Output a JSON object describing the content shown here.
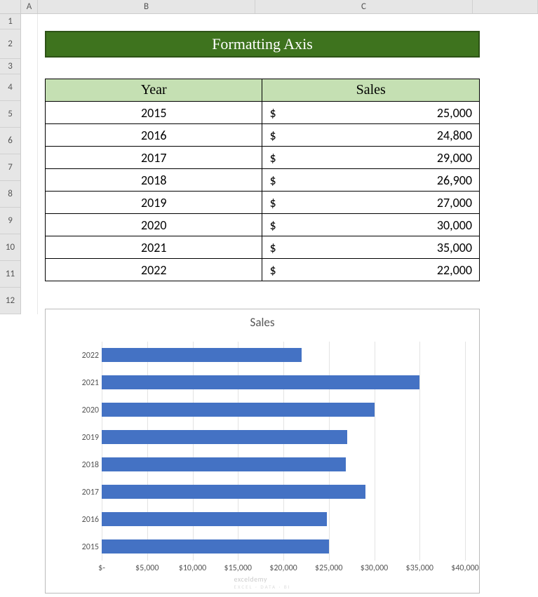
{
  "columns": [
    "A",
    "B",
    "C"
  ],
  "rows": [
    "1",
    "2",
    "3",
    "4",
    "5",
    "6",
    "7",
    "8",
    "9",
    "10",
    "11",
    "12"
  ],
  "banner": {
    "title": "Formatting Axis"
  },
  "table": {
    "headers": {
      "year": "Year",
      "sales": "Sales"
    },
    "currency": "$",
    "rows": [
      {
        "year": "2015",
        "sales": "25,000"
      },
      {
        "year": "2016",
        "sales": "24,800"
      },
      {
        "year": "2017",
        "sales": "29,000"
      },
      {
        "year": "2018",
        "sales": "26,900"
      },
      {
        "year": "2019",
        "sales": "27,000"
      },
      {
        "year": "2020",
        "sales": "30,000"
      },
      {
        "year": "2021",
        "sales": "35,000"
      },
      {
        "year": "2022",
        "sales": "22,000"
      }
    ]
  },
  "chart_data": {
    "type": "bar",
    "title": "Sales",
    "orientation": "horizontal",
    "categories": [
      "2022",
      "2021",
      "2020",
      "2019",
      "2018",
      "2017",
      "2016",
      "2015"
    ],
    "values": [
      22000,
      35000,
      30000,
      27000,
      26900,
      29000,
      24800,
      25000
    ],
    "xlabel": "",
    "ylabel": "",
    "xlim": [
      0,
      40000
    ],
    "xticks_labels": [
      "$-",
      "$5,000",
      "$10,000",
      "$15,000",
      "$20,000",
      "$25,000",
      "$30,000",
      "$35,000",
      "$40,000"
    ],
    "xticks_values": [
      0,
      5000,
      10000,
      15000,
      20000,
      25000,
      30000,
      35000,
      40000
    ],
    "series_color": "#4472c4"
  },
  "watermark": {
    "main": "exceldemy",
    "sub": "EXCEL · DATA · BI"
  }
}
